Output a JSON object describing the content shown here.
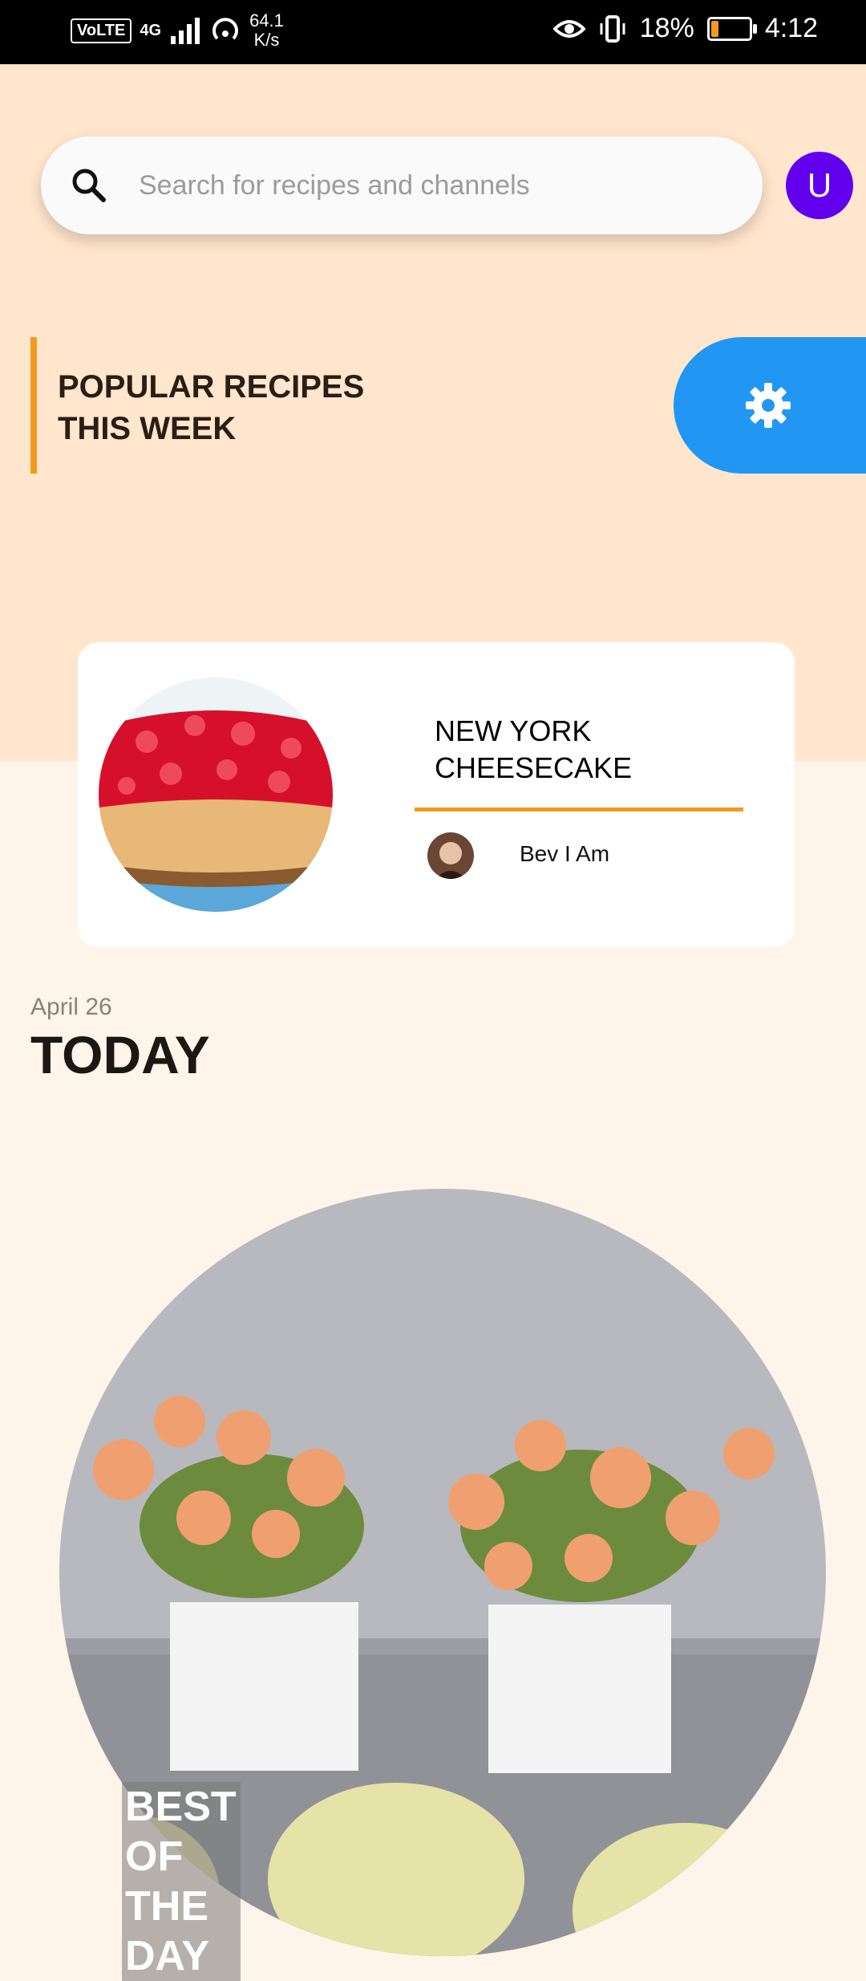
{
  "status_bar": {
    "network": "VoLTE",
    "signal_type": "4G",
    "speed_value": "64.1",
    "speed_unit": "K/s",
    "battery_percent": "18%",
    "battery_level": 0.18,
    "time": "4:12"
  },
  "search": {
    "placeholder": "Search for recipes and channels"
  },
  "profile": {
    "initial": "U"
  },
  "popular": {
    "title": "POPULAR RECIPES THIS WEEK"
  },
  "recipe": {
    "title": "NEW YORK CHEESECAKE",
    "author": "Bev I Am"
  },
  "today": {
    "date": "April 26",
    "heading": "TODAY",
    "feature_label": "BEST OF THE DAY"
  },
  "colors": {
    "accent_orange": "#f39a1e",
    "settings_blue": "#2196f3",
    "avatar_purple": "#6200ee",
    "hero_bg": "#ffe6cc",
    "page_bg": "#fff4ea"
  }
}
